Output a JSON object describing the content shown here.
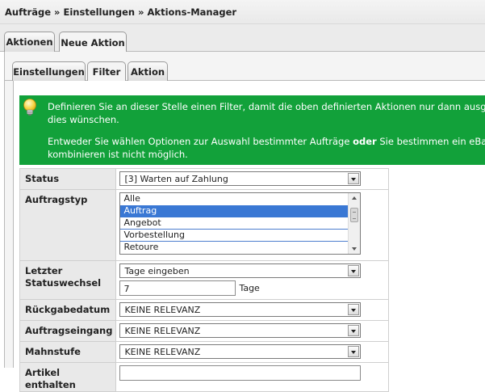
{
  "breadcrumb": "Aufträge » Einstellungen » Aktions-Manager",
  "tabs": [
    "Aktionen",
    "Neue Aktion"
  ],
  "subtabs": [
    "Einstellungen",
    "Filter",
    "Aktion"
  ],
  "info": {
    "line1": "Definieren Sie an dieser Stelle einen Filter, damit die oben definierten Aktionen nur dann ausgeführt werden, wenn Sie",
    "line2": "dies wünschen.",
    "line3_pre": "Entweder Sie wählen Optionen zur Auswahl bestimmter Aufträge ",
    "line3_bold": "oder",
    "line3_post": " Sie bestimmen ein eBay-Angebot. Beides",
    "line4": "kombinieren ist nicht möglich."
  },
  "form": {
    "status_label": "Status",
    "status_value": "[3] Warten auf Zahlung",
    "auftragstyp_label": "Auftragstyp",
    "auftragstyp_options": [
      "Alle",
      "Auftrag",
      "Angebot",
      "Vorbestellung",
      "Retoure"
    ],
    "auftragstyp_selected": "Auftrag",
    "statuswechsel_label_1": "Letzter",
    "statuswechsel_label_2": "Statuswechsel",
    "statuswechsel_value": "Tage eingeben",
    "statuswechsel_days": "7",
    "statuswechsel_unit": "Tage",
    "rueckgabe_label": "Rückgabedatum",
    "rueckgabe_value": "KEINE RELEVANZ",
    "eingang_label": "Auftragseingang",
    "eingang_value": "KEINE RELEVANZ",
    "mahnstufe_label": "Mahnstufe",
    "mahnstufe_value": "KEINE RELEVANZ",
    "artikel_label": "Artikel enthalten"
  },
  "colors": {
    "info_bg": "#12a13a",
    "selection": "#3a78d4"
  },
  "icons": {
    "info": "lightbulb-icon",
    "dropdown": "chevron-down-icon"
  }
}
